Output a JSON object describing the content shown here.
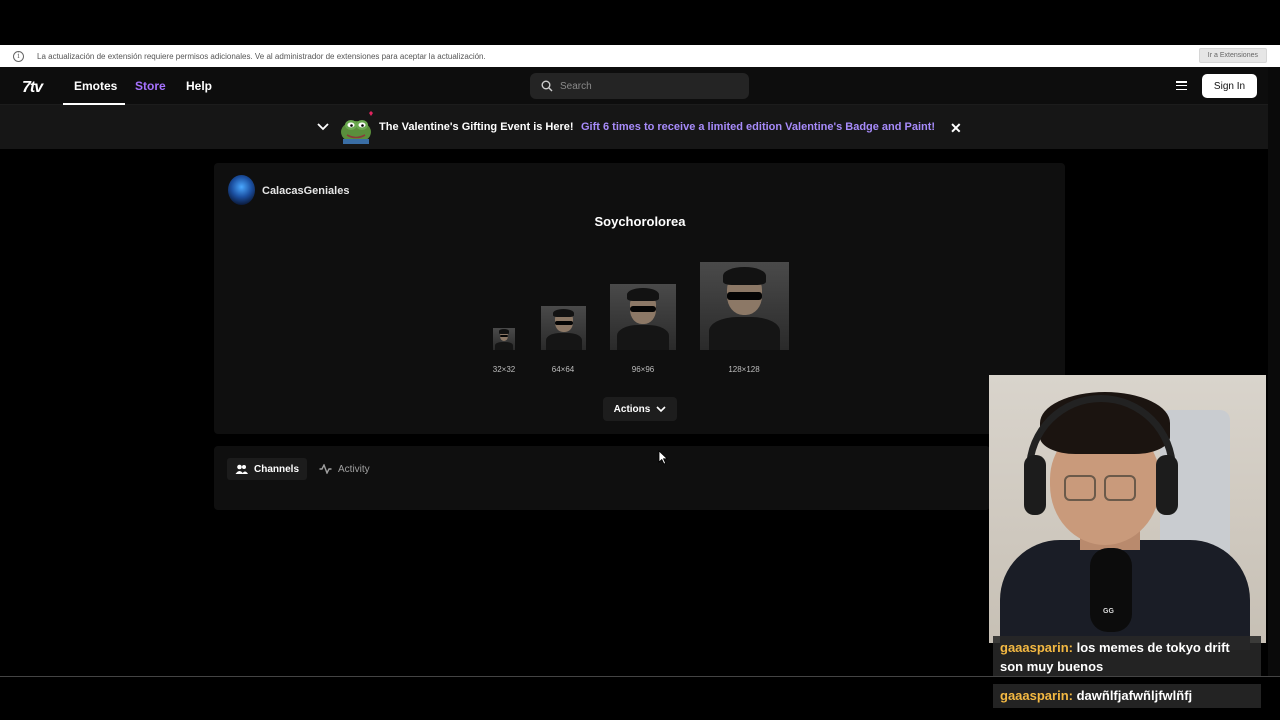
{
  "infobar": {
    "message": "La actualización de extensión requiere permisos adicionales. Ve al administrador de extensiones para aceptar la actualización.",
    "button": "Ir a Extensiones",
    "icon": "info-icon"
  },
  "nav": {
    "logo": "7tv",
    "links": {
      "emotes": "Emotes",
      "store": "Store",
      "help": "Help"
    },
    "search_placeholder": "Search",
    "signin": "Sign In",
    "accent_color": "#a672ff"
  },
  "banner": {
    "title": "The Valentine's Gifting Event is Here!",
    "link": "Gift 6 times to receive a limited edition Valentine's Badge and Paint!",
    "close": "✕"
  },
  "emote": {
    "owner": "CalacasGeniales",
    "name": "Soychorolorea",
    "sizes": [
      "32×32",
      "64×64",
      "96×96",
      "128×128"
    ],
    "actions": "Actions"
  },
  "tabs": {
    "channels": "Channels",
    "activity": "Activity"
  },
  "webcam": {
    "mic_label": "GG"
  },
  "chat": [
    {
      "user": "gaaasparin:",
      "text": " los memes de tokyo drift son muy buenos"
    },
    {
      "user": "gaaasparin:",
      "text": " dawñlfjafwñljfwlñfj"
    }
  ]
}
